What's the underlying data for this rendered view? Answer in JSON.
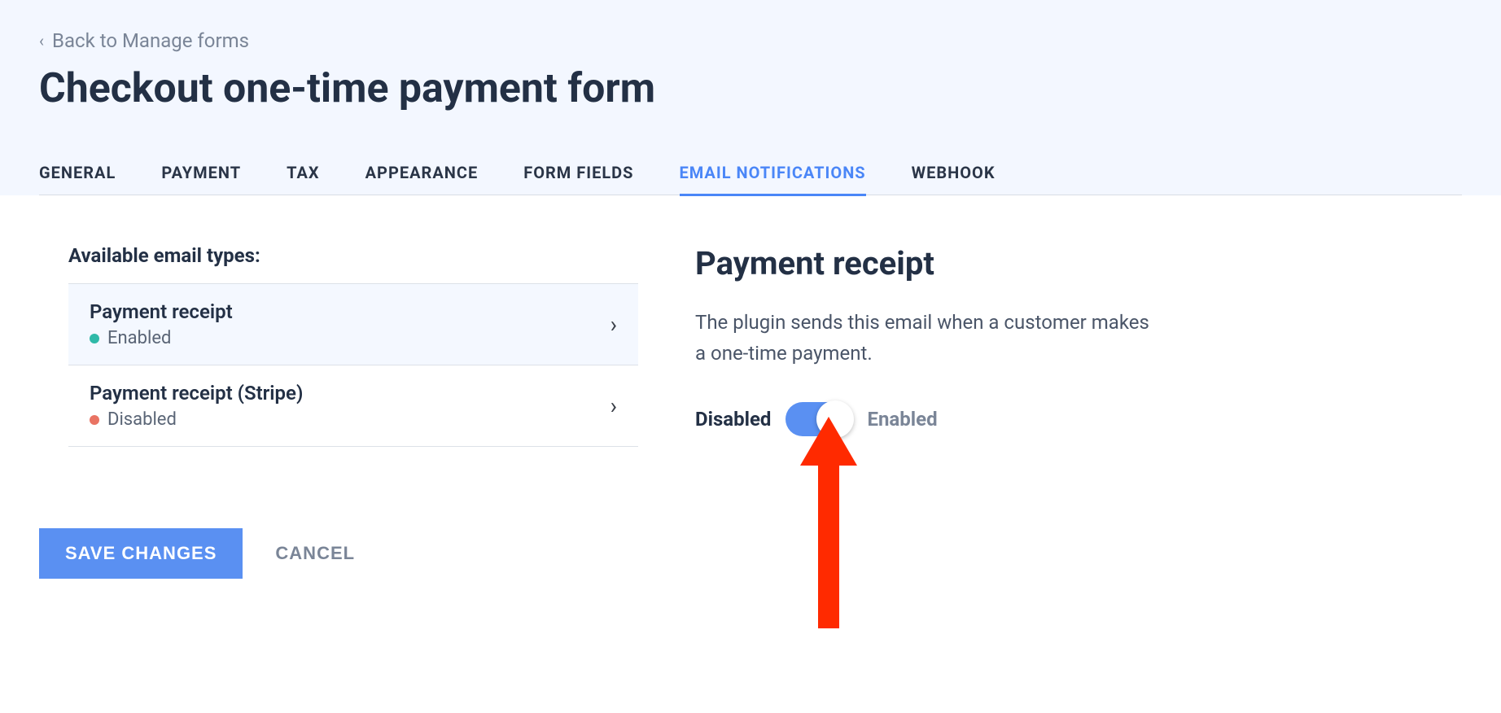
{
  "header": {
    "back_label": "Back to Manage forms",
    "title": "Checkout one-time payment form"
  },
  "tabs": {
    "general": "GENERAL",
    "payment": "PAYMENT",
    "tax": "TAX",
    "appearance": "APPEARANCE",
    "form_fields": "FORM FIELDS",
    "email_notifications": "EMAIL NOTIFICATIONS",
    "webhook": "WEBHOOK"
  },
  "email_types": {
    "section_label": "Available email types:",
    "items": [
      {
        "title": "Payment receipt",
        "status": "Enabled",
        "selected": true,
        "enabled": true
      },
      {
        "title": "Payment receipt (Stripe)",
        "status": "Disabled",
        "selected": false,
        "enabled": false
      }
    ]
  },
  "detail": {
    "title": "Payment receipt",
    "description": "The plugin sends this email when a customer makes a one-time payment.",
    "toggle_disabled_label": "Disabled",
    "toggle_enabled_label": "Enabled"
  },
  "buttons": {
    "save": "SAVE CHANGES",
    "cancel": "CANCEL"
  }
}
